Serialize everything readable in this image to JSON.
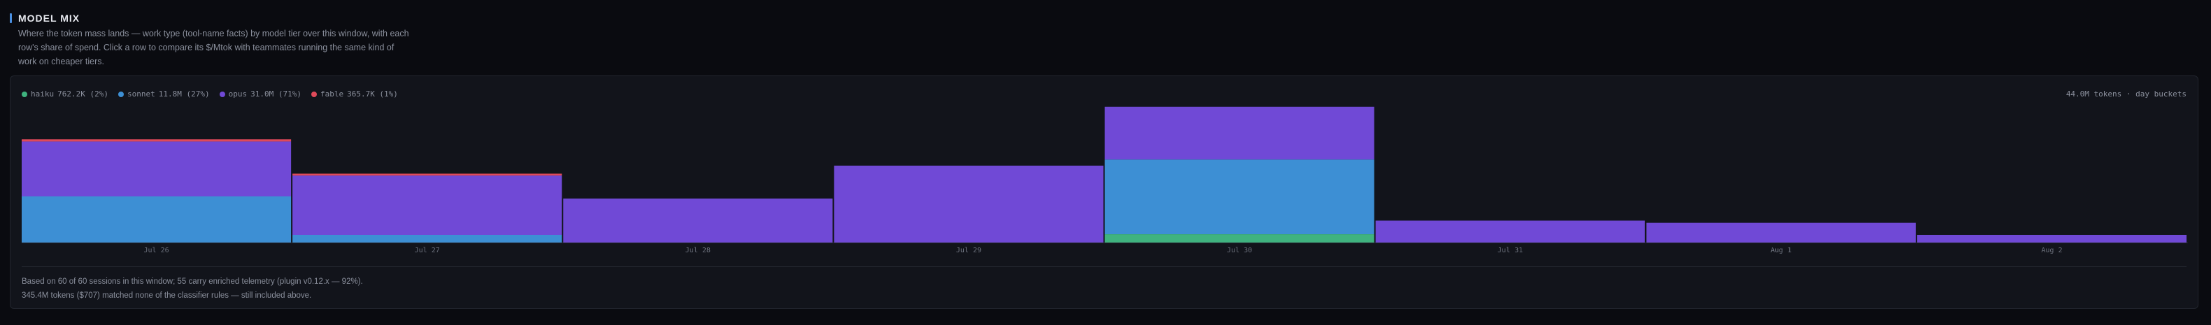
{
  "header": {
    "title": "MODEL MIX",
    "description": "Where the token mass lands — work type (tool-name facts) by model tier over this window, with each row's share of spend. Click a row to compare its $/Mtok with teammates running the same kind of work on cheaper tiers."
  },
  "legend": [
    {
      "name": "haiku",
      "value": "762.2K (2%)",
      "color": "#3fb37f"
    },
    {
      "name": "sonnet",
      "value": "11.8M (27%)",
      "color": "#3d8fd4"
    },
    {
      "name": "opus",
      "value": "31.0M (71%)",
      "color": "#7049d6"
    },
    {
      "name": "fable",
      "value": "365.7K (1%)",
      "color": "#e04a5a"
    }
  ],
  "meta": "44.0M tokens · day buckets",
  "chart_data": {
    "type": "bar",
    "stacked": true,
    "categories": [
      "Jul 26",
      "Jul 27",
      "Jul 28",
      "Jul 29",
      "Jul 30",
      "Jul 31",
      "Aug 1",
      "Aug 2"
    ],
    "series": [
      {
        "name": "haiku",
        "color": "#3fb37f",
        "values": [
          0,
          0,
          0,
          0,
          0.76,
          0,
          0,
          0
        ]
      },
      {
        "name": "sonnet",
        "color": "#3d8fd4",
        "values": [
          4.2,
          0.7,
          0,
          0,
          6.8,
          0,
          0,
          0
        ]
      },
      {
        "name": "opus",
        "color": "#7049d6",
        "values": [
          5.0,
          5.4,
          4.0,
          7.0,
          4.8,
          2.0,
          1.8,
          0.7
        ]
      },
      {
        "name": "fable",
        "color": "#e04a5a",
        "values": [
          0.2,
          0.17,
          0,
          0,
          0,
          0,
          0,
          0
        ]
      }
    ],
    "ylim": [
      0,
      12.6
    ],
    "grid": false
  },
  "footnote": {
    "line1": "Based on 60 of 60 sessions in this window; 55 carry enriched telemetry (plugin v0.12.x — 92%).",
    "line2": "345.4M tokens ($707) matched none of the classifier rules — still included above."
  }
}
